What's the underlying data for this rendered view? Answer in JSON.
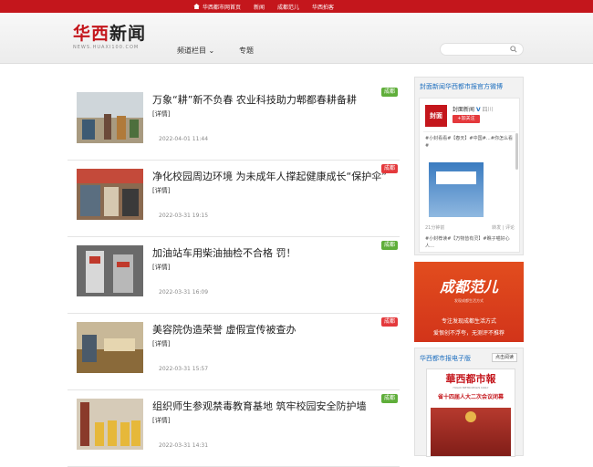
{
  "topbar": {
    "links": [
      "华西都市网首页",
      "新闻",
      "成都范儿",
      "华西拍客"
    ]
  },
  "logo": {
    "text_red": "华西",
    "text_dark": "新闻",
    "sub": "NEWS.HUAXI100.COM"
  },
  "nav": {
    "channels": "频道栏目",
    "channels_arrow": "⌄",
    "topics": "专题"
  },
  "search": {
    "placeholder": ""
  },
  "articles": [
    {
      "title": "万象“耕”新不负春 农业科技助力郫都春耕备耕",
      "detail": "[详情]",
      "date": "2022-04-01 11:44",
      "tag": "成都",
      "tag_color": "#5fae3a"
    },
    {
      "title": "净化校园周边环境 为未成年人撑起健康成长“保护伞”",
      "detail": "[详情]",
      "date": "2022-03-31 19:15",
      "tag": "成都",
      "tag_color": "#e4393c"
    },
    {
      "title": "加油站车用柴油抽检不合格 罚！",
      "detail": "[详情]",
      "date": "2022-03-31 16:09",
      "tag": "成都",
      "tag_color": "#5fae3a"
    },
    {
      "title": "美容院伪造荣誉 虚假宣传被查办",
      "detail": "[详情]",
      "date": "2022-03-31 15:57",
      "tag": "成都",
      "tag_color": "#e4393c"
    },
    {
      "title": "组织师生参观禁毒教育基地 筑牢校园安全防护墙",
      "detail": "[详情]",
      "date": "2022-03-31 14:31",
      "tag": "成都",
      "tag_color": "#5fae3a"
    }
  ],
  "weibo": {
    "title": "封面新闻华西都市报官方微博",
    "logo_text": "封面",
    "name": "封面新闻",
    "verified": "V",
    "location": "四川",
    "follow": "+加关注",
    "post1": "#小封看看#【春天】#中国#…#你怎么看#",
    "image_label": "",
    "meta_left": "21分钟前",
    "meta_right": "转发 | 评论",
    "post2": "#小封荐读#【万物皆有灵】#瞧子喵好心人…"
  },
  "promo": {
    "brand": "成都范儿",
    "brand_sub": "发现成都生活方式",
    "line1": "专注发现成都生活方式",
    "line2": "爱恨创不浮夸，无测评不推荐"
  },
  "epaper": {
    "title": "华西都市报电子版",
    "read": "点击阅读",
    "masthead": "華西都市報",
    "masthead_sub": "HUAXI METROPOLIS DAILY",
    "headline": "省十四届人大二次会议闭幕"
  },
  "colors": {
    "brand_red": "#c4161c",
    "link_blue": "#1e6fbf"
  }
}
